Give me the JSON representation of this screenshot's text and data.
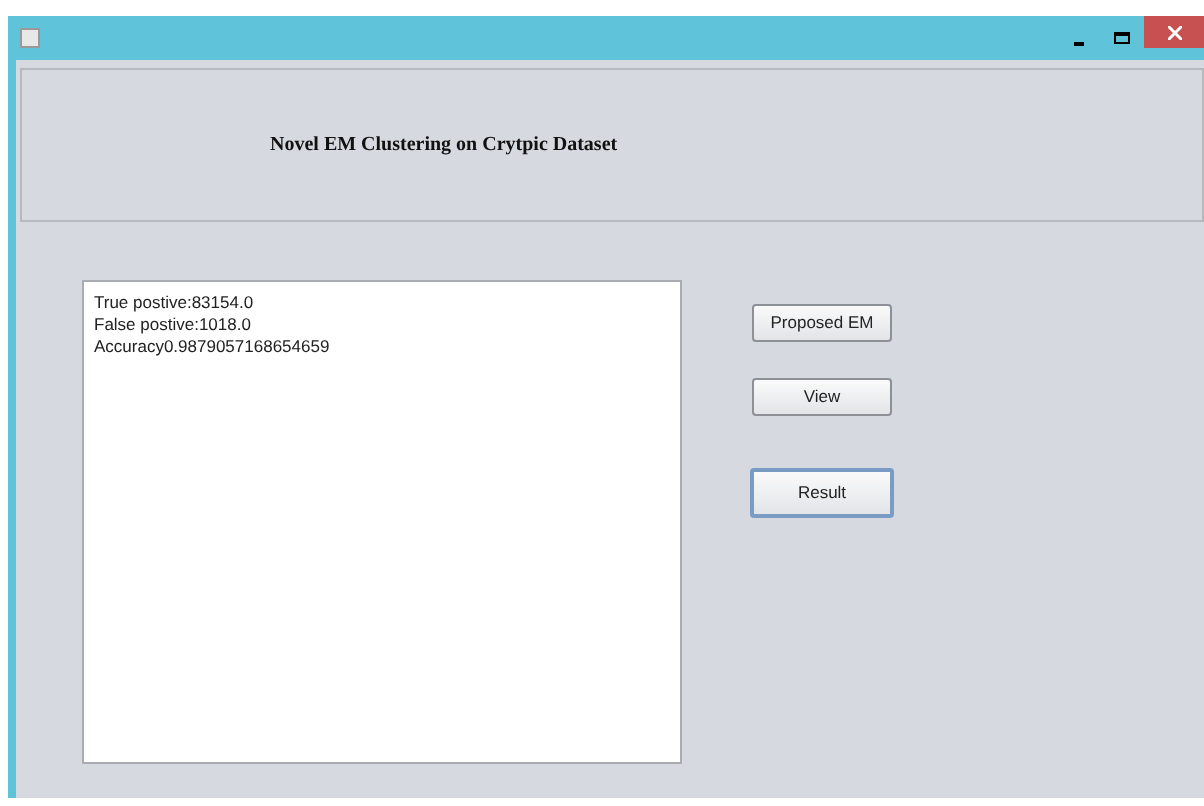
{
  "header": {
    "title": "Novel EM Clustering on Crytpic Dataset"
  },
  "output": {
    "lines": [
      "True postive:83154.0",
      "False postive:1018.0",
      "Accuracy0.9879057168654659"
    ]
  },
  "buttons": [
    {
      "label": "Proposed EM",
      "focused": false
    },
    {
      "label": "View",
      "focused": false
    },
    {
      "label": "Result",
      "focused": true
    }
  ]
}
